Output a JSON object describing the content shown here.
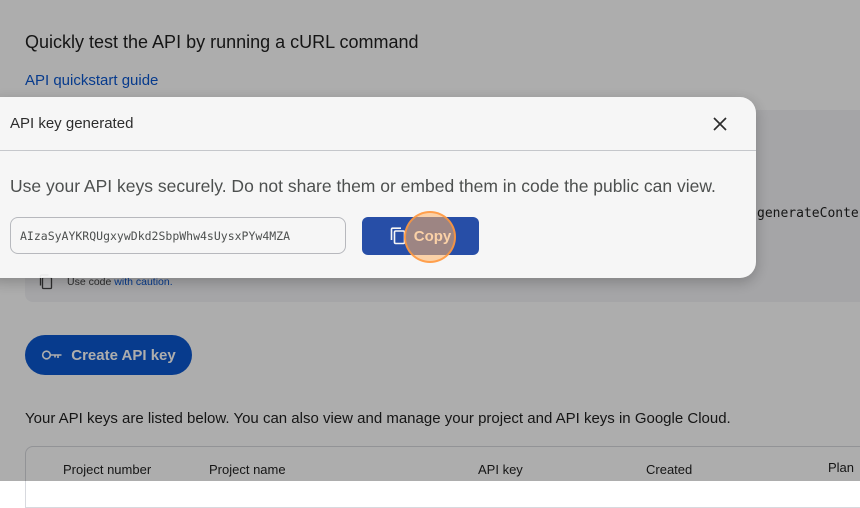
{
  "page": {
    "heading": "Quickly test the API by running a cURL command",
    "quickstart_link": "API quickstart guide",
    "code_fragment": "generateConte",
    "caution_prefix": "Use code",
    "caution_link": "with caution.",
    "create_button": "Create API key",
    "keys_description": "Your API keys are listed below. You can also view and manage your project and API keys in Google Cloud.",
    "table_headers": [
      "Project number",
      "Project name",
      "API key",
      "Created",
      "Plan"
    ]
  },
  "dialog": {
    "title": "API key generated",
    "warning": "Use your API keys securely. Do not share them or embed them in code the public can view.",
    "api_key_value": "AIzaSyAYKRQUgxywDkd2SbpWhw4sUysxPYw4MZA",
    "copy_button": "Copy"
  },
  "icons": {
    "close": "close-icon",
    "copy": "copy-icon",
    "key": "key-icon",
    "code_copy": "copy-code-icon"
  },
  "colors": {
    "primary_blue": "#0b57d0",
    "copy_button_blue": "#1a45a8",
    "click_indicator": "#ffb266"
  }
}
